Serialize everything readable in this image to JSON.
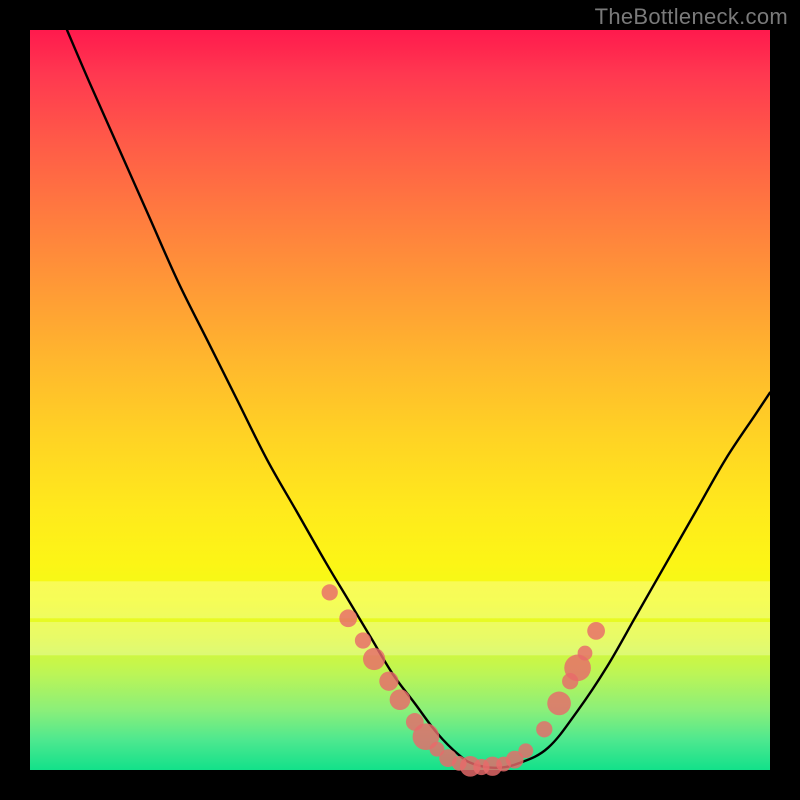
{
  "attribution": "TheBottleneck.com",
  "colors": {
    "frame": "#000000",
    "curve_stroke": "#000000",
    "dot_fill": "#e86a6a",
    "gradient_top": "#ff1a4d",
    "gradient_bottom": "#12e18a"
  },
  "chart_data": {
    "type": "line",
    "title": "",
    "xlabel": "",
    "ylabel": "",
    "xlim": [
      0,
      100
    ],
    "ylim": [
      0,
      100
    ],
    "grid": false,
    "series": [
      {
        "name": "bottleneck-curve",
        "x": [
          5,
          8,
          12,
          16,
          20,
          24,
          28,
          32,
          36,
          40,
          43,
          46,
          49,
          52,
          55,
          58,
          60,
          63,
          66,
          70,
          74,
          78,
          82,
          86,
          90,
          94,
          98,
          100
        ],
        "values": [
          100,
          93,
          84,
          75,
          66,
          58,
          50,
          42,
          35,
          28,
          23,
          18,
          13,
          9,
          5,
          2,
          0.8,
          0.3,
          0.9,
          3,
          8,
          14,
          21,
          28,
          35,
          42,
          48,
          51
        ]
      }
    ],
    "markers": [
      {
        "x": 40.5,
        "y": 24.0,
        "r": 1.1
      },
      {
        "x": 43.0,
        "y": 20.5,
        "r": 1.2
      },
      {
        "x": 45.0,
        "y": 17.5,
        "r": 1.1
      },
      {
        "x": 46.5,
        "y": 15.0,
        "r": 1.5
      },
      {
        "x": 48.5,
        "y": 12.0,
        "r": 1.3
      },
      {
        "x": 50.0,
        "y": 9.5,
        "r": 1.4
      },
      {
        "x": 52.0,
        "y": 6.5,
        "r": 1.2
      },
      {
        "x": 53.5,
        "y": 4.5,
        "r": 1.8
      },
      {
        "x": 55.0,
        "y": 2.8,
        "r": 1.0
      },
      {
        "x": 56.5,
        "y": 1.6,
        "r": 1.2
      },
      {
        "x": 58.0,
        "y": 0.9,
        "r": 1.0
      },
      {
        "x": 59.5,
        "y": 0.5,
        "r": 1.4
      },
      {
        "x": 61.0,
        "y": 0.4,
        "r": 1.1
      },
      {
        "x": 62.5,
        "y": 0.5,
        "r": 1.3
      },
      {
        "x": 64.0,
        "y": 0.8,
        "r": 1.0
      },
      {
        "x": 65.5,
        "y": 1.4,
        "r": 1.2
      },
      {
        "x": 67.0,
        "y": 2.6,
        "r": 1.0
      },
      {
        "x": 69.5,
        "y": 5.5,
        "r": 1.1
      },
      {
        "x": 71.5,
        "y": 9.0,
        "r": 1.6
      },
      {
        "x": 73.0,
        "y": 12.0,
        "r": 1.1
      },
      {
        "x": 74.0,
        "y": 13.8,
        "r": 1.8
      },
      {
        "x": 75.0,
        "y": 15.8,
        "r": 1.0
      },
      {
        "x": 76.5,
        "y": 18.8,
        "r": 1.2
      }
    ],
    "haze_bands": [
      {
        "y_top": 25.5,
        "y_bottom": 20.5
      },
      {
        "y_top": 20.0,
        "y_bottom": 15.5
      }
    ]
  }
}
